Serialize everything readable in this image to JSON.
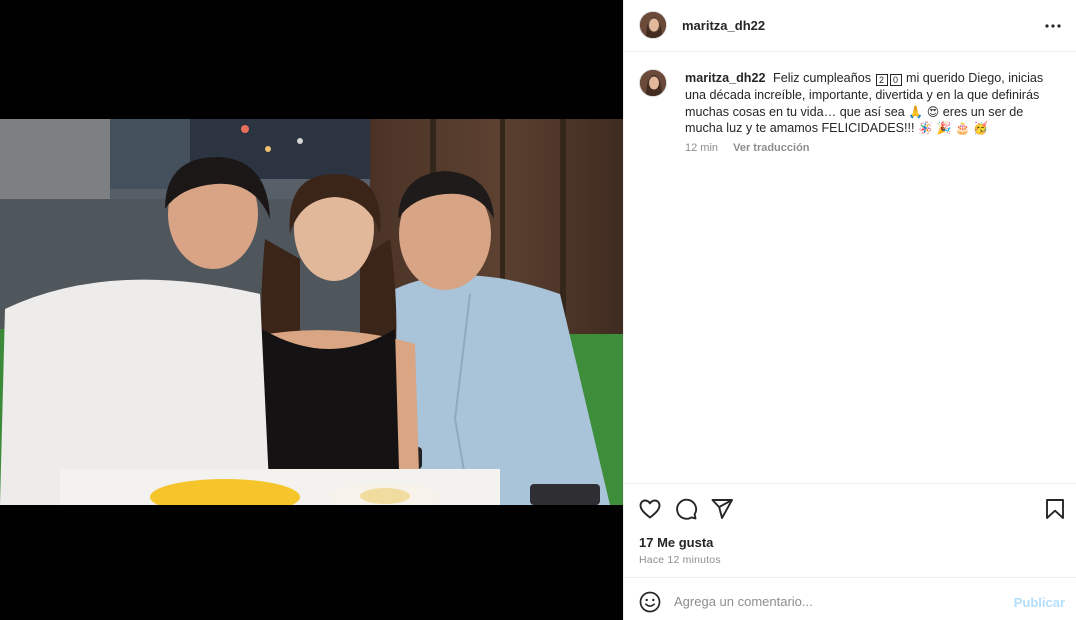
{
  "post": {
    "username": "maritza_dh22",
    "caption": {
      "username": "maritza_dh22",
      "part1": "Feliz cumpleaños",
      "digits": [
        "2",
        "0"
      ],
      "part2": "mi querido Diego, inicias una década increíble, importante, divertida y en la que definirás muchas cosas en tu vida… que así sea",
      "emojis1": [
        "🙏",
        "😍"
      ],
      "part3": "eres un ser de mucha luz y te amamos FELICIDADES!!!",
      "emojis2": [
        "🪅",
        "🎉",
        "🎂",
        "🥳"
      ]
    },
    "comment_time": "12 min",
    "translate_label": "Ver traducción",
    "likes": "17 Me gusta",
    "posted_time": "Hace 12 minutos",
    "comment_placeholder": "Agrega un comentario...",
    "publish_label": "Publicar"
  },
  "icons": {
    "more": "more-options-icon",
    "like": "heart-icon",
    "comment": "comment-icon",
    "share": "paper-plane-icon",
    "save": "bookmark-icon",
    "emoji": "smiley-icon"
  },
  "colors": {
    "text": "#262626",
    "muted": "#8e8e8e",
    "border": "#efefef",
    "publish_disabled": "#b2dffc",
    "media_bg": "#000000"
  }
}
